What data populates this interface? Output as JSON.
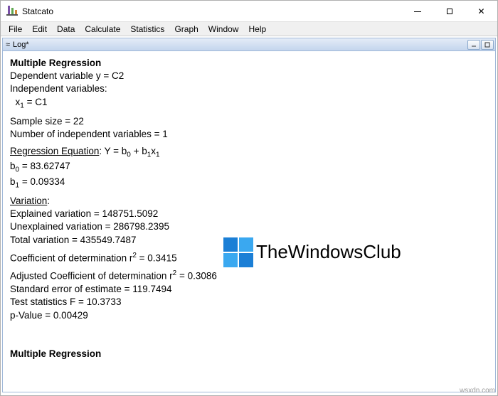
{
  "window": {
    "title": "Statcato"
  },
  "menu": {
    "file": "File",
    "edit": "Edit",
    "data": "Data",
    "calculate": "Calculate",
    "statistics": "Statistics",
    "graph": "Graph",
    "window": "Window",
    "help": "Help"
  },
  "subwindow": {
    "icon_prefix": "≈",
    "title": "Log*"
  },
  "content": {
    "heading1": "Multiple Regression",
    "dep_var": "Dependent variable y = C2",
    "ind_var_label": "Independent variables:",
    "x1_eq_prefix": "x",
    "x1_eq_sub": "1",
    "x1_eq_suffix": " = C1",
    "sample_size": "Sample size = 22",
    "num_indep": "Number of independent variables = 1",
    "regeq_label": "Regression Equation",
    "regeq_colon": ": Y = b",
    "regeq_sub0": "0",
    "regeq_plus": " + b",
    "regeq_sub1": "1",
    "regeq_x": "x",
    "regeq_xsub": "1",
    "b0_pre": "b",
    "b0_sub": "0",
    "b0_val": " = 83.62747",
    "b1_pre": "b",
    "b1_sub": "1",
    "b1_val": " = 0.09334",
    "variation_label": "Variation",
    "variation_colon": ":",
    "expl_var": "Explained variation = 148751.5092",
    "unexpl_var": "Unexplained variation = 286798.2395",
    "total_var": "Total variation = 435549.7487",
    "coef_det_pre": "Coefficient of determination r",
    "coef_det_sup": "2",
    "coef_det_val": " = 0.3415",
    "adj_coef_pre": "Adjusted Coefficient of determination r",
    "adj_coef_sup": "2",
    "adj_coef_val": " = 0.3086",
    "std_err": "Standard error of estimate = 119.7494",
    "test_stat": "Test statistics F = 10.3733",
    "pval": "p-Value = 0.00429",
    "heading2": "Multiple Regression"
  },
  "watermark": {
    "text": "TheWindowsClub"
  },
  "source": "wsxdn.com"
}
